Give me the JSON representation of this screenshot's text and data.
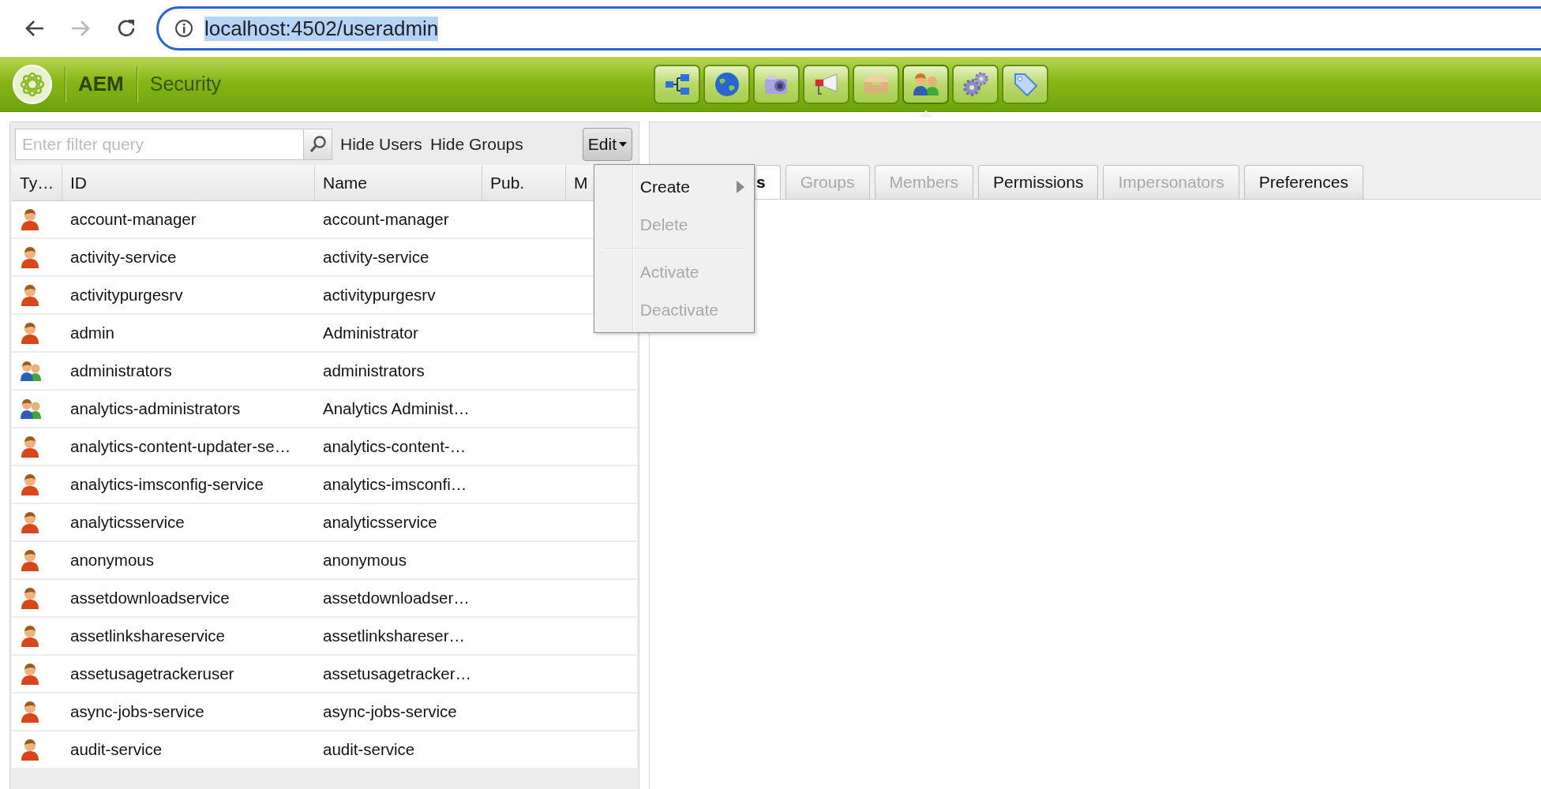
{
  "browser": {
    "url": "localhost:4502/useradmin",
    "url_highlighted": true,
    "back_disabled": false,
    "forward_disabled": true
  },
  "header": {
    "product": "AEM",
    "section": "Security"
  },
  "tools": [
    {
      "kind": "hierarchy",
      "selected": false
    },
    {
      "kind": "globe",
      "selected": false
    },
    {
      "kind": "camera",
      "selected": false
    },
    {
      "kind": "megaphone",
      "selected": false
    },
    {
      "kind": "inbox",
      "selected": false
    },
    {
      "kind": "users",
      "selected": true
    },
    {
      "kind": "gears",
      "selected": false
    },
    {
      "kind": "tag",
      "selected": false
    }
  ],
  "filter": {
    "placeholder": "Enter filter query"
  },
  "toggles": [
    "Hide Users",
    "Hide Groups"
  ],
  "edit_button": "Edit",
  "edit_menu": [
    {
      "kind": "item",
      "label": "Create",
      "disabled": false,
      "submenu": true
    },
    {
      "kind": "item",
      "label": "Delete",
      "disabled": true,
      "submenu": false
    },
    {
      "kind": "separator"
    },
    {
      "kind": "item",
      "label": "Activate",
      "disabled": true,
      "submenu": false
    },
    {
      "kind": "item",
      "label": "Deactivate",
      "disabled": true,
      "submenu": false
    }
  ],
  "table": {
    "columns": [
      "Ty…",
      "ID",
      "Name",
      "Pub.",
      "M"
    ],
    "rows": [
      {
        "kind": "user",
        "id": "account-manager",
        "name": "account-manager"
      },
      {
        "kind": "user",
        "id": "activity-service",
        "name": "activity-service"
      },
      {
        "kind": "user",
        "id": "activitypurgesrv",
        "name": "activitypurgesrv"
      },
      {
        "kind": "user",
        "id": "admin",
        "name": "Administrator"
      },
      {
        "kind": "group",
        "id": "administrators",
        "name": "administrators"
      },
      {
        "kind": "group",
        "id": "analytics-administrators",
        "name": "Analytics Administ…"
      },
      {
        "kind": "user",
        "id": "analytics-content-updater-se…",
        "name": "analytics-content-…"
      },
      {
        "kind": "user",
        "id": "analytics-imsconfig-service",
        "name": "analytics-imsconfi…"
      },
      {
        "kind": "user",
        "id": "analyticsservice",
        "name": "analyticsservice"
      },
      {
        "kind": "user",
        "id": "anonymous",
        "name": "anonymous"
      },
      {
        "kind": "user",
        "id": "assetdownloadservice",
        "name": "assetdownloadser…"
      },
      {
        "kind": "user",
        "id": "assetlinkshareservice",
        "name": "assetlinkshareser…"
      },
      {
        "kind": "user",
        "id": "assetusagetrackeruser",
        "name": "assetusagetracker…"
      },
      {
        "kind": "user",
        "id": "async-jobs-service",
        "name": "async-jobs-service"
      },
      {
        "kind": "user",
        "id": "audit-service",
        "name": "audit-service"
      }
    ]
  },
  "tabs": [
    {
      "label": "s",
      "selected": true,
      "disabled": false
    },
    {
      "label": "Groups",
      "selected": false,
      "disabled": true
    },
    {
      "label": "Members",
      "selected": false,
      "disabled": true
    },
    {
      "label": "Permissions",
      "selected": false,
      "disabled": false
    },
    {
      "label": "Impersonators",
      "selected": false,
      "disabled": true
    },
    {
      "label": "Preferences",
      "selected": false,
      "disabled": false
    }
  ]
}
